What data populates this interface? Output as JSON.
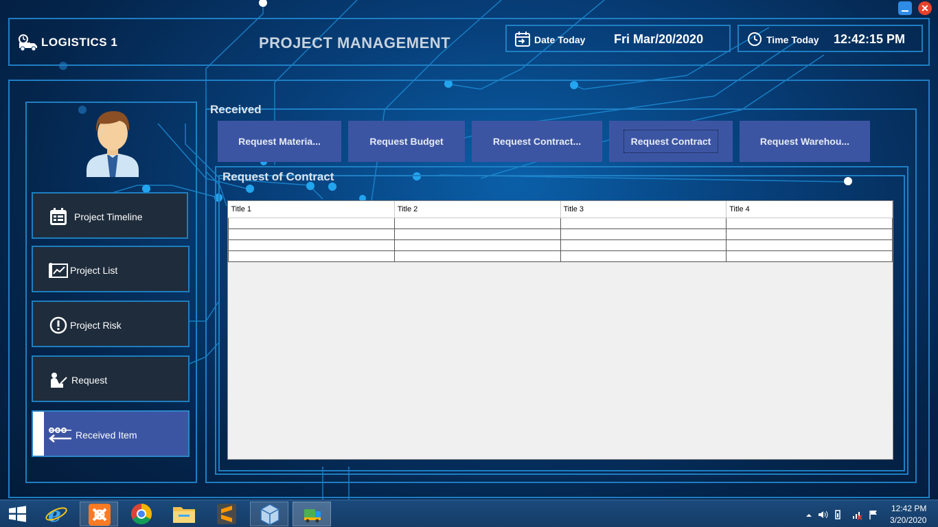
{
  "window": {
    "close_symbol": "✕"
  },
  "header": {
    "logo_text": "LOGISTICS 1",
    "title": "PROJECT MANAGEMENT",
    "date_label": "Date Today",
    "date_value": "Fri Mar/20/2020",
    "time_label": "Time Today",
    "time_value": "12:42:15 PM"
  },
  "sidebar": {
    "items": [
      {
        "label": "Project Timeline",
        "icon": "calendar-icon"
      },
      {
        "label": "Project List",
        "icon": "chart-scroll-icon"
      },
      {
        "label": "Project Risk",
        "icon": "exclamation-icon"
      },
      {
        "label": "Request",
        "icon": "person-writing-icon"
      },
      {
        "label": "Received Item",
        "icon": "receive-arrow-icon",
        "active": true
      }
    ]
  },
  "content": {
    "section_title": "Received",
    "tabs": [
      {
        "label": "Request Materia..."
      },
      {
        "label": "Request Budget"
      },
      {
        "label": "Request Contract..."
      },
      {
        "label": "Request Contract",
        "focused": true
      },
      {
        "label": "Request Warehou..."
      }
    ],
    "sub_title": "Request of Contract",
    "grid": {
      "columns": [
        "Title 1",
        "Title 2",
        "Title 3",
        "Title 4"
      ],
      "empty_rows": 4
    }
  },
  "taskbar": {
    "apps": [
      "start-icon",
      "internet-explorer-icon",
      "xampp-icon",
      "chrome-icon",
      "file-explorer-icon",
      "sublime-text-icon",
      "virtualbox-icon",
      "logistics-app-icon"
    ],
    "clock_time": "12:42 PM",
    "clock_date": "3/20/2020"
  },
  "colors": {
    "accent": "#1f7fc4",
    "tab": "#3c55a3",
    "nav_bg": "#1f2c3b"
  }
}
